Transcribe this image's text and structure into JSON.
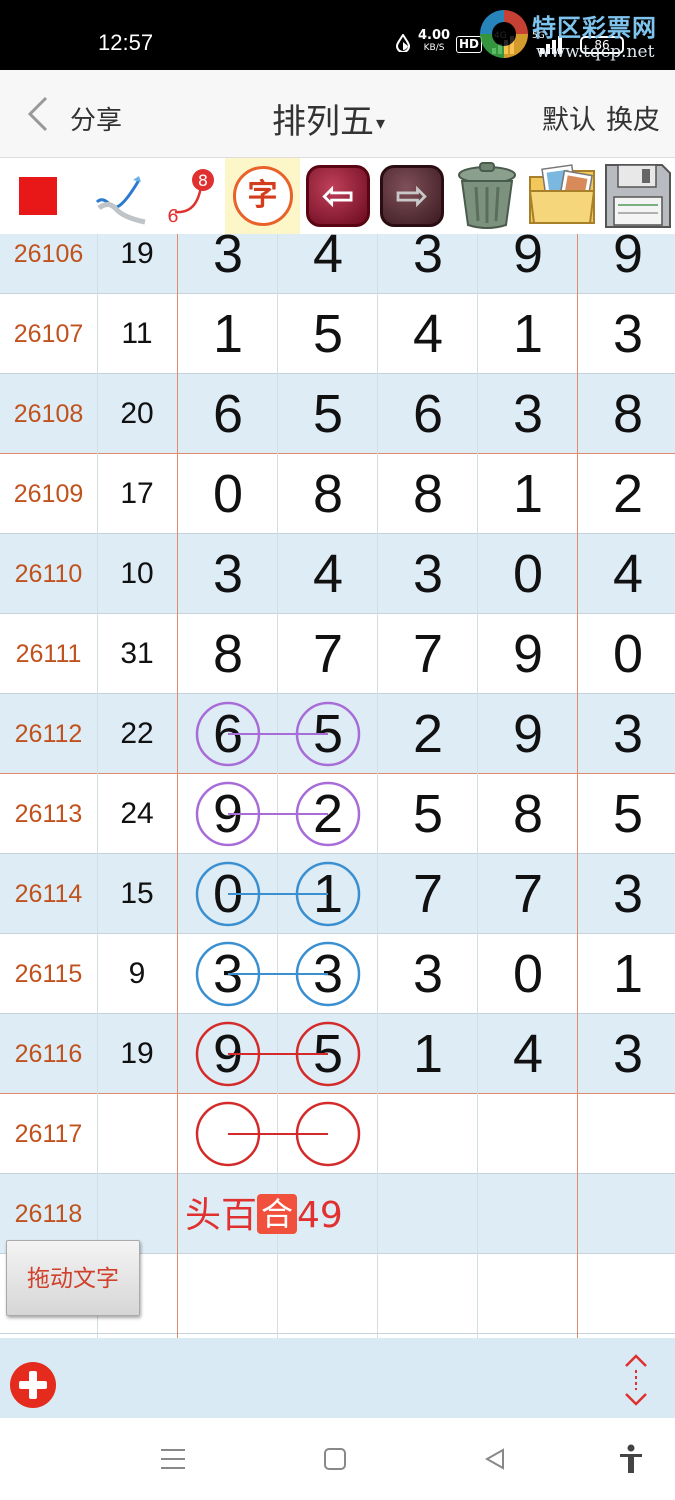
{
  "status_bar": {
    "time": "12:57",
    "net_speed": "4.00",
    "net_unit": "KB/S",
    "hd": "HD",
    "signal_1": "4G",
    "signal_2": "5G",
    "battery": "86",
    "watermark_text": "特区彩票网",
    "watermark_url": "www.tqcp.net"
  },
  "header": {
    "back_icon": "chevron-left-icon",
    "share": "分享",
    "title": "排列五",
    "title_caret": "▾",
    "default": "默认",
    "skin": "换皮"
  },
  "toolbar": {
    "items": [
      "red-square-icon",
      "pen-check-icon",
      "number-link-icon",
      "zi-char-icon",
      "back-arrow-icon",
      "forward-arrow-icon",
      "trash-icon",
      "photo-folder-icon",
      "floppy-save-icon"
    ],
    "zi": "字",
    "link_top": "8",
    "link_bottom": "6",
    "back_glyph": "⇦",
    "forward_glyph": "⇨",
    "colors": {
      "red": "#e81818",
      "shade": "#deecf5",
      "issue": "#c0521e"
    }
  },
  "table": {
    "rows": [
      {
        "issue": "26106",
        "sum": "19",
        "digits": [
          "3",
          "4",
          "3",
          "9",
          "9"
        ]
      },
      {
        "issue": "26107",
        "sum": "11",
        "digits": [
          "1",
          "5",
          "4",
          "1",
          "3"
        ]
      },
      {
        "issue": "26108",
        "sum": "20",
        "digits": [
          "6",
          "5",
          "6",
          "3",
          "8"
        ]
      },
      {
        "issue": "26109",
        "sum": "17",
        "digits": [
          "0",
          "8",
          "8",
          "1",
          "2"
        ]
      },
      {
        "issue": "26110",
        "sum": "10",
        "digits": [
          "3",
          "4",
          "3",
          "0",
          "4"
        ]
      },
      {
        "issue": "26111",
        "sum": "31",
        "digits": [
          "8",
          "7",
          "7",
          "9",
          "0"
        ]
      },
      {
        "issue": "26112",
        "sum": "22",
        "digits": [
          "6",
          "5",
          "2",
          "9",
          "3"
        ]
      },
      {
        "issue": "26113",
        "sum": "24",
        "digits": [
          "9",
          "2",
          "5",
          "8",
          "5"
        ]
      },
      {
        "issue": "26114",
        "sum": "15",
        "digits": [
          "0",
          "1",
          "7",
          "7",
          "3"
        ]
      },
      {
        "issue": "26115",
        "sum": "9",
        "digits": [
          "3",
          "3",
          "3",
          "0",
          "1"
        ]
      },
      {
        "issue": "26116",
        "sum": "19",
        "digits": [
          "9",
          "5",
          "1",
          "4",
          "3"
        ]
      },
      {
        "issue": "26117",
        "sum": "",
        "digits": [
          "",
          "",
          "",
          "",
          ""
        ]
      },
      {
        "issue": "26118",
        "sum": "",
        "digits": [
          "",
          "",
          "",
          "",
          ""
        ]
      },
      {
        "issue": "",
        "sum": "",
        "digits": [
          "",
          "",
          "",
          "",
          ""
        ]
      }
    ],
    "annotation_prefix": "头百",
    "annotation_he": "合",
    "annotation_value": "49",
    "circle_colors": {
      "purple": "#a86cd8",
      "blue": "#3a8fd0",
      "red": "#d42a2a"
    }
  },
  "drag_button": "拖动文字",
  "bottom_bar": {
    "add_icon": "plus-circle-icon",
    "expand_icon": "up-down-arrows-icon"
  },
  "nav_bar": {
    "items": [
      "menu-icon",
      "home-icon",
      "back-triangle-icon",
      "accessibility-icon"
    ]
  }
}
